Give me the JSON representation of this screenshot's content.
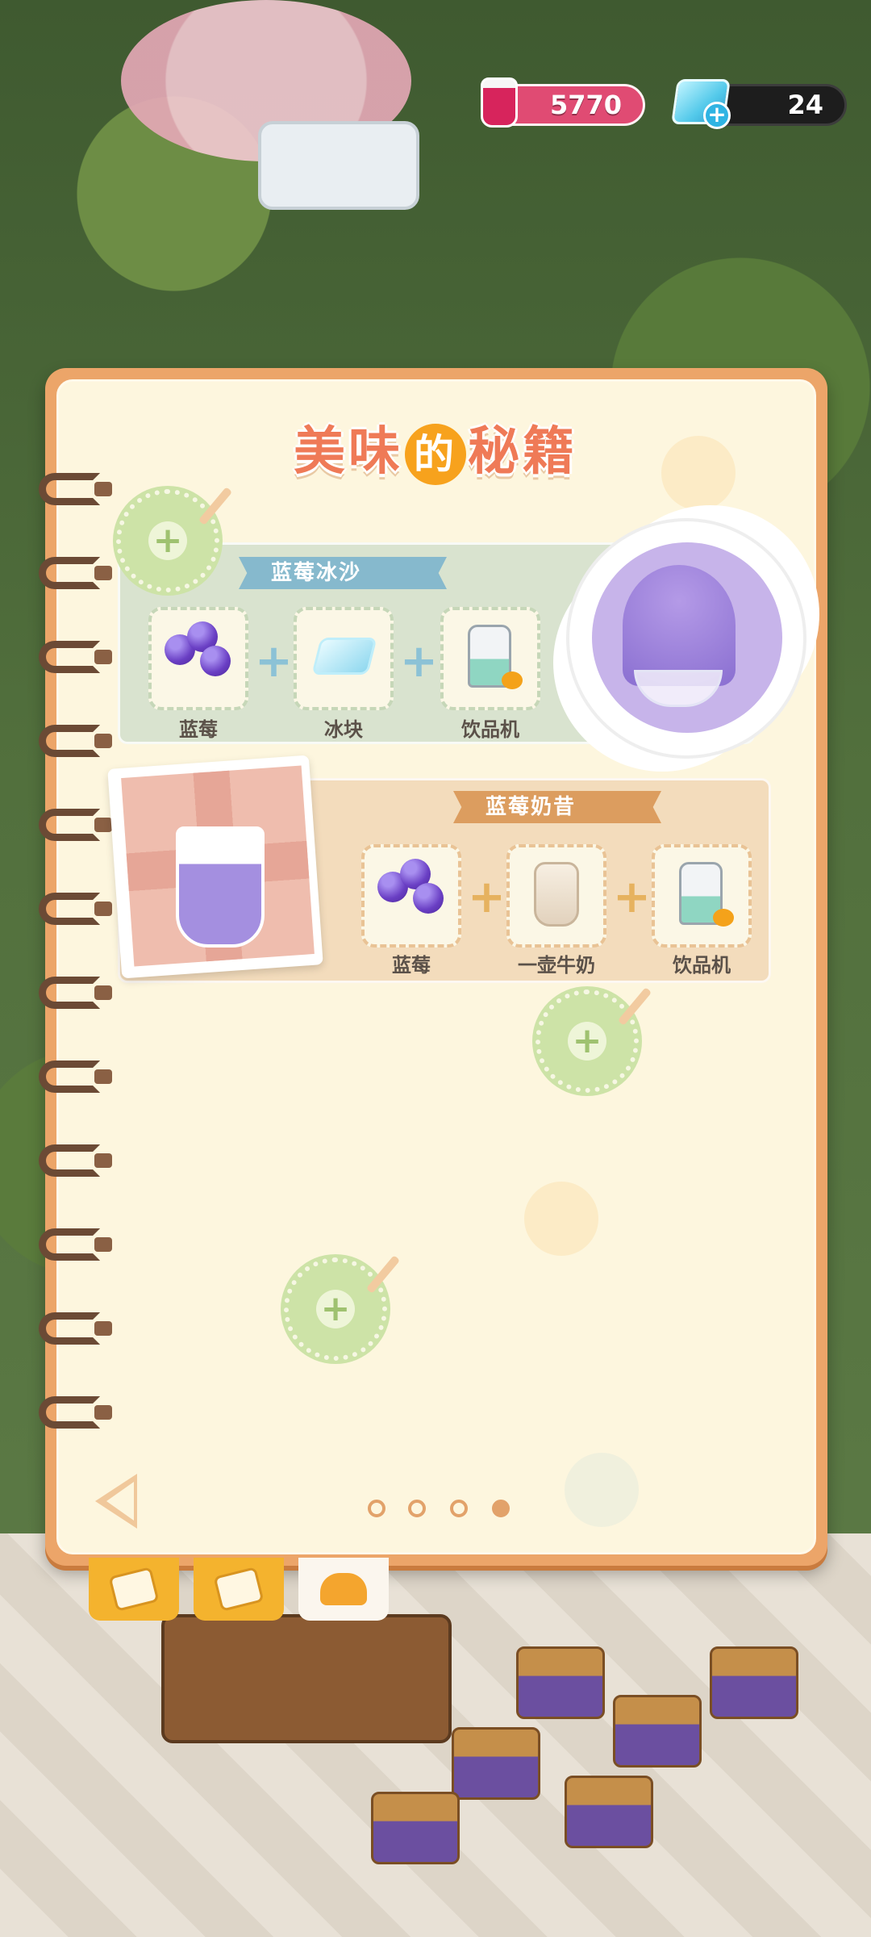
{
  "hud": {
    "jam_amount": "5770",
    "gem_amount": "24",
    "gem_add_icon": "plus"
  },
  "book": {
    "title_parts": [
      "美",
      "味",
      "的",
      "秘籍"
    ]
  },
  "recipes": [
    {
      "name": "蓝莓冰沙",
      "ingredients": [
        {
          "label": "蓝莓",
          "icon": "blueberry-icon"
        },
        {
          "label": "冰块",
          "icon": "ice-cube-icon"
        },
        {
          "label": "饮品机",
          "icon": "drink-machine-icon"
        }
      ],
      "dish_icon": "blueberry-shaved-ice-icon"
    },
    {
      "name": "蓝莓奶昔",
      "ingredients": [
        {
          "label": "蓝莓",
          "icon": "blueberry-icon"
        },
        {
          "label": "一壶牛奶",
          "icon": "milk-jug-icon"
        },
        {
          "label": "饮品机",
          "icon": "drink-machine-icon"
        }
      ],
      "dish_icon": "blueberry-milkshake-icon"
    }
  ],
  "pagination": {
    "pages": 4,
    "current": 4
  },
  "tabs": [
    {
      "icon": "note-icon",
      "active": false
    },
    {
      "icon": "note-icon",
      "active": false
    },
    {
      "icon": "chef-hat-icon",
      "active": true
    }
  ],
  "colors": {
    "book_cover": "#eca569",
    "page": "#fdf6de",
    "title": "#ef7a57",
    "ribbon_blue": "#86b9cd",
    "ribbon_orange": "#dc9d5f",
    "jam_pill": "#e04b73"
  }
}
